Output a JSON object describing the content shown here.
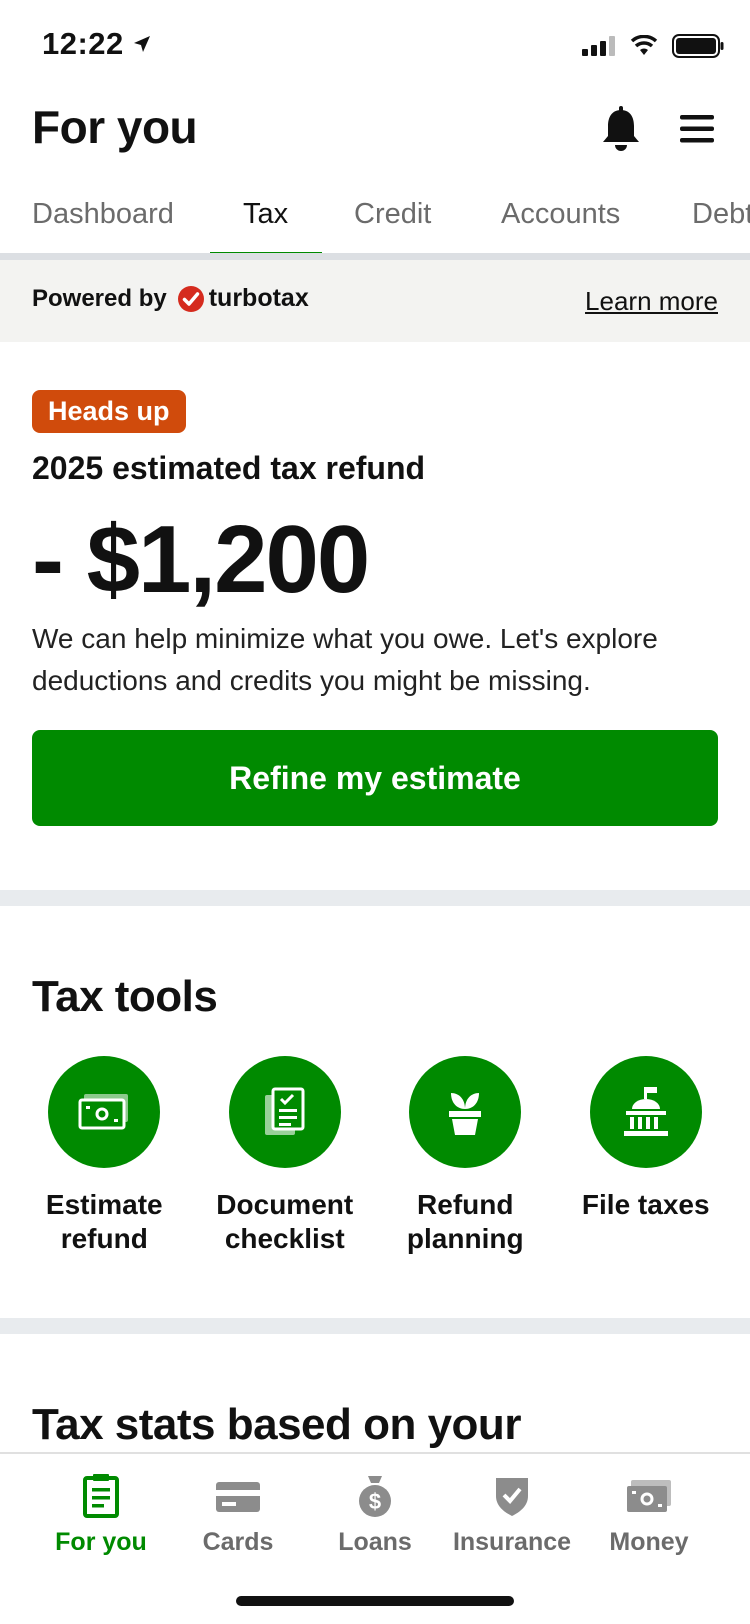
{
  "status_bar": {
    "time": "12:22"
  },
  "header": {
    "title": "For you"
  },
  "tabs": [
    {
      "label": "Dashboard",
      "active": false
    },
    {
      "label": "Tax",
      "active": true
    },
    {
      "label": "Credit",
      "active": false
    },
    {
      "label": "Accounts",
      "active": false
    },
    {
      "label": "Debt",
      "active": false
    }
  ],
  "powered": {
    "prefix": "Powered by",
    "brand": "turbotax",
    "link": "Learn more"
  },
  "refund_card": {
    "badge": "Heads up",
    "label": "2025 estimated tax refund",
    "amount": "- $1,200",
    "description": "We can help minimize what you owe. Let's explore deductions and credits you might be missing.",
    "button": "Refine my estimate"
  },
  "tax_tools": {
    "title": "Tax tools",
    "items": [
      {
        "label": "Estimate\nrefund",
        "icon": "money-bill-icon"
      },
      {
        "label": "Document\nchecklist",
        "icon": "document-checklist-icon"
      },
      {
        "label": "Refund\nplanning",
        "icon": "plant-icon"
      },
      {
        "label": "File taxes",
        "icon": "government-building-icon"
      }
    ]
  },
  "tax_stats": {
    "title": "Tax stats based on your"
  },
  "bottom_nav": [
    {
      "label": "For you",
      "icon": "document-icon",
      "active": true
    },
    {
      "label": "Cards",
      "icon": "card-icon",
      "active": false
    },
    {
      "label": "Loans",
      "icon": "money-bag-icon",
      "active": false
    },
    {
      "label": "Insurance",
      "icon": "shield-check-icon",
      "active": false
    },
    {
      "label": "Money",
      "icon": "money-bill-icon",
      "active": false
    }
  ],
  "colors": {
    "accent": "#008a00",
    "badge": "#d04b0c",
    "turbotax": "#d52b1e"
  }
}
